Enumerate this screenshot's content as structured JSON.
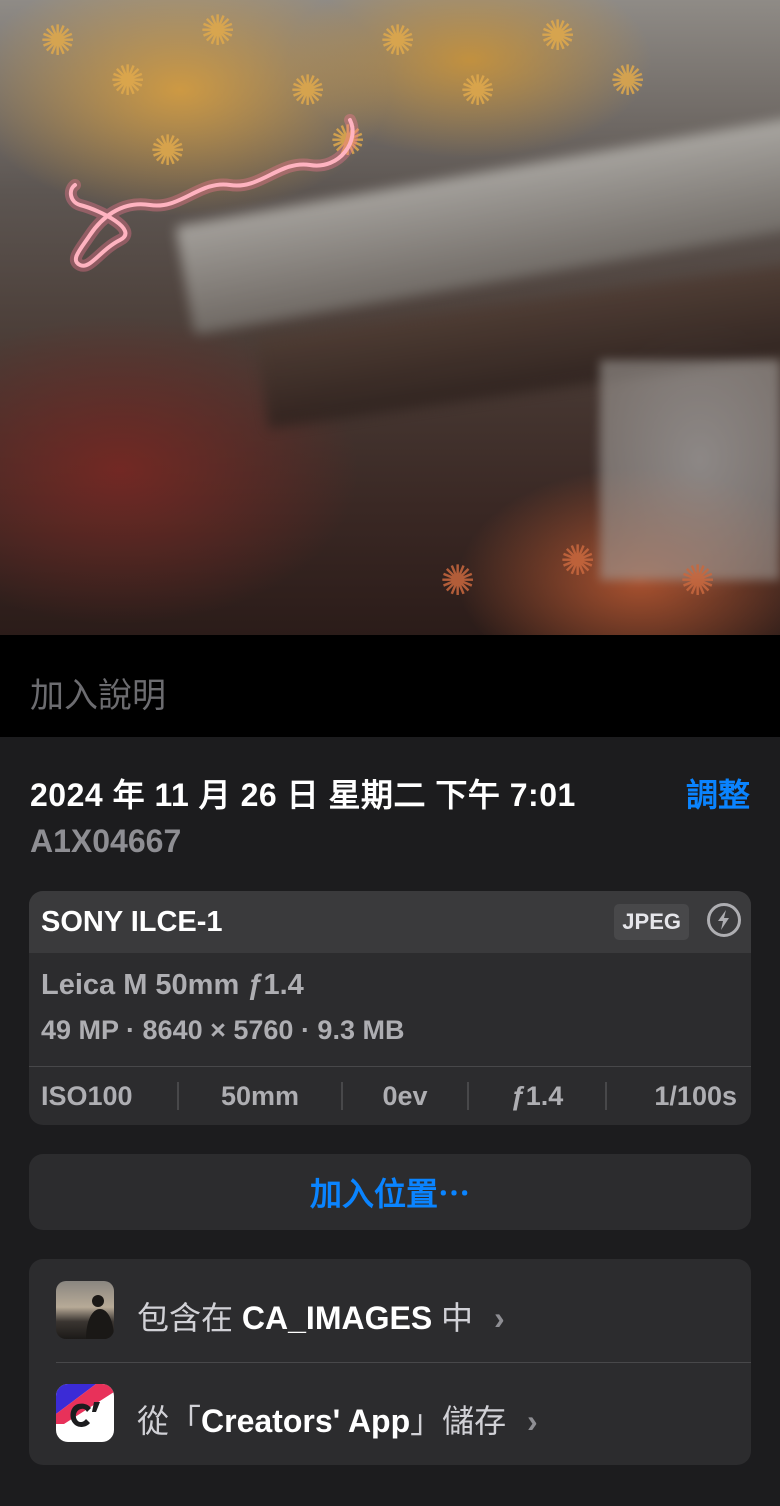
{
  "photo": {
    "description_icon": "photo-preview"
  },
  "caption": {
    "placeholder": "加入說明"
  },
  "info": {
    "datetime": "2024 年 11 月 26 日 星期二 下午 7:01",
    "adjust_label": "調整",
    "filename": "A1X04667"
  },
  "metadata": {
    "camera": "SONY ILCE-1",
    "format": "JPEG",
    "flash_icon": "flash-off-icon",
    "lens": "Leica M 50mm ƒ1.4",
    "specs": "49 MP · 8640 × 5760 · 9.3 MB",
    "exif": {
      "iso": "ISO100",
      "focal": "50mm",
      "ev": "0ev",
      "aperture": "ƒ1.4",
      "shutter": "1/100s"
    }
  },
  "location": {
    "label": "加入位置⋯"
  },
  "albums": {
    "included_prefix": "包含在",
    "album_name": "CA_IMAGES",
    "included_suffix": "中",
    "saved_prefix": "從「",
    "app_name": "Creators' App",
    "saved_suffix": "」儲存",
    "chevron": "›"
  },
  "colors": {
    "accent": "#0a84ff",
    "background": "#1c1c1e",
    "card": "#2c2c2e"
  }
}
